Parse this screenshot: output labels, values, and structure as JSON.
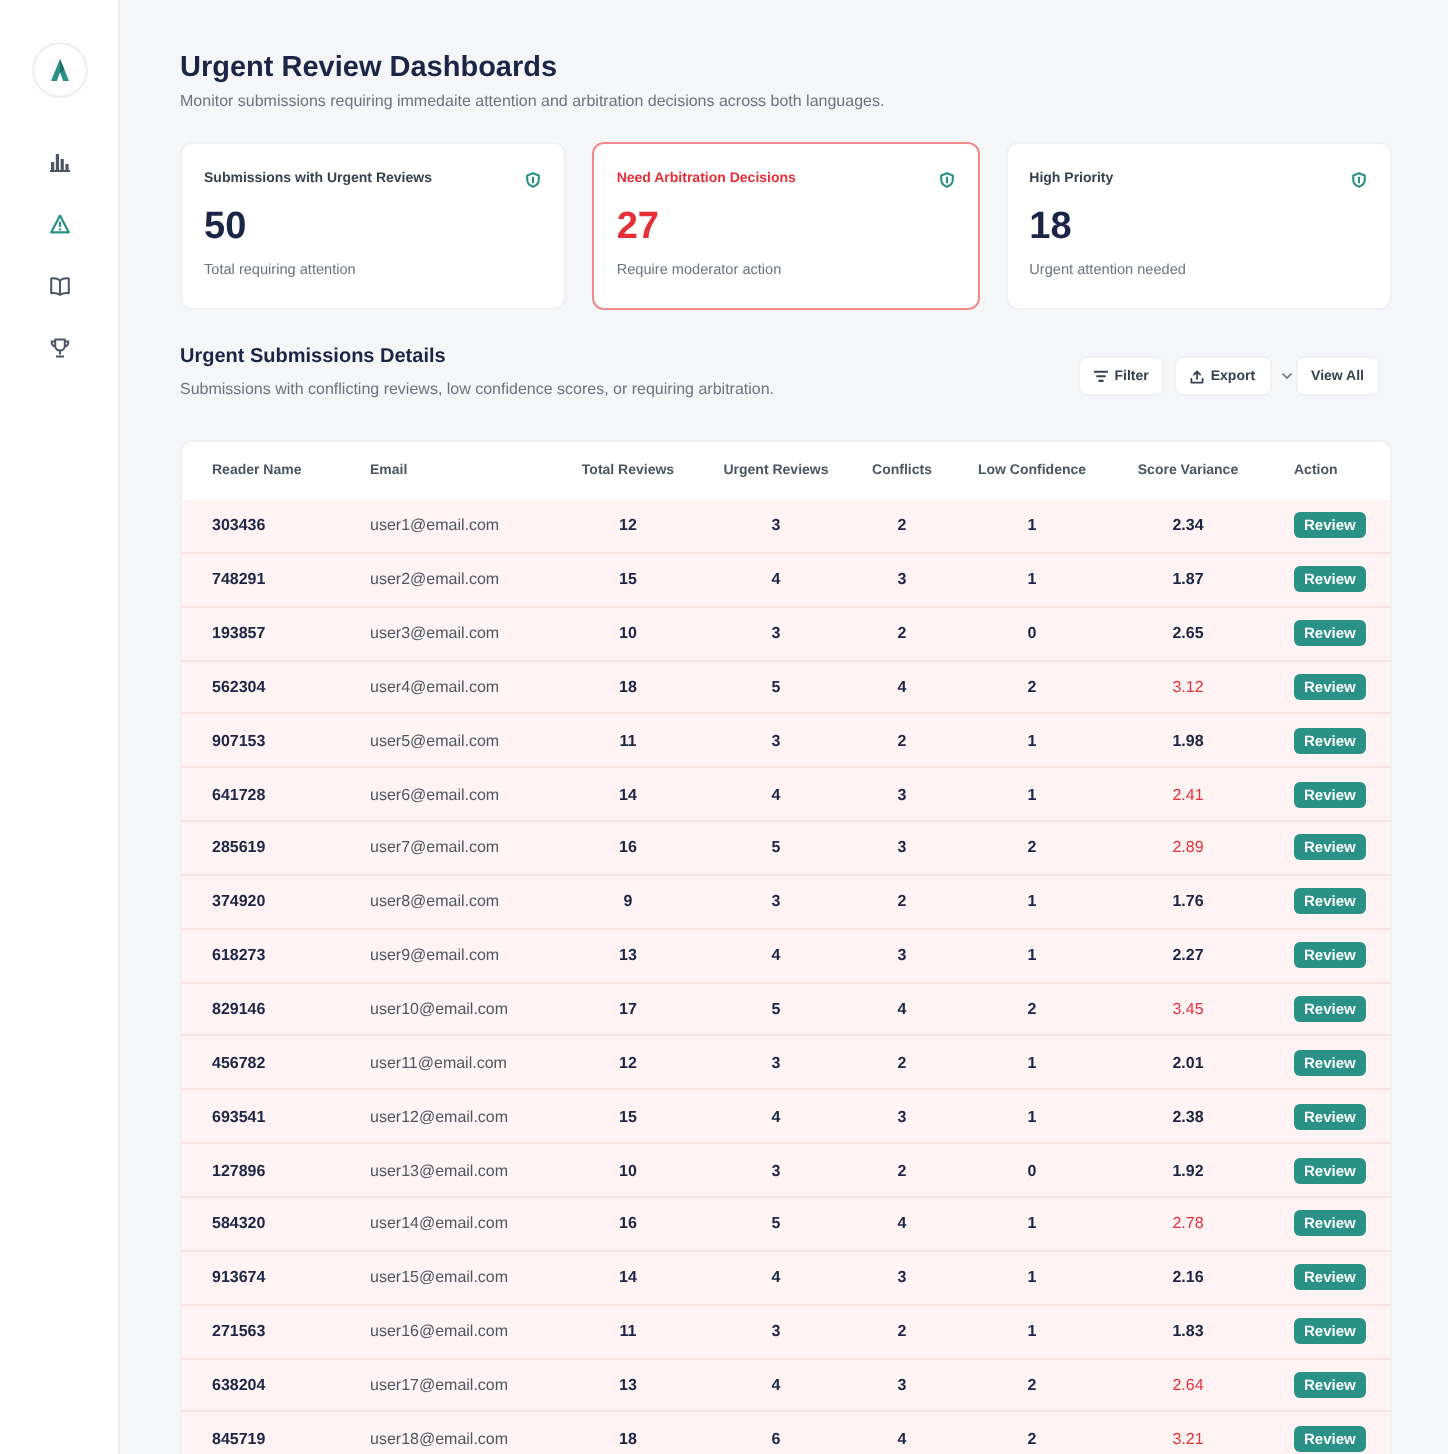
{
  "sidebar": {
    "items": [
      {
        "kind": "chart",
        "selected": false
      },
      {
        "kind": "alert",
        "selected": true
      },
      {
        "kind": "book",
        "selected": false
      },
      {
        "kind": "trophy",
        "selected": false
      }
    ]
  },
  "header": {
    "title": "Urgent Review Dashboards",
    "subtitle": "Monitor submissions requiring immedaite attention and arbitration decisions across both languages."
  },
  "cards": [
    {
      "title": "Submissions with Urgent Reviews",
      "value": "50",
      "caption": "Total requiring attention",
      "highlighted": false
    },
    {
      "title": "Need Arbitration Decisions",
      "value": "27",
      "caption": "Require moderator action",
      "highlighted": true
    },
    {
      "title": "High Priority",
      "value": "18",
      "caption": "Urgent attention needed",
      "highlighted": false
    }
  ],
  "section": {
    "title": "Urgent Submissions Details",
    "subtitle": "Submissions with conflicting reviews, low confidence scores, or requiring arbitration.",
    "buttons": [
      {
        "kind": "filter",
        "label": "Filter"
      },
      {
        "kind": "export",
        "label": "Export"
      },
      {
        "kind": "view_all",
        "label": "View All"
      }
    ]
  },
  "table": {
    "columns": [
      "Reader Name",
      "Email",
      "Total Reviews",
      "Urgent Reviews",
      "Conflicts",
      "Low Confidence",
      "Score Variance",
      "Action"
    ],
    "rows": [
      {
        "reader_name": "303436",
        "email": "user1@email.com",
        "total_reviews": "12",
        "urgent_reviews": "3",
        "conflicts": "2",
        "low_confidence": "1",
        "score_variance": "2.34",
        "variance_flagged": false,
        "action": "Review"
      },
      {
        "reader_name": "748291",
        "email": "user2@email.com",
        "total_reviews": "15",
        "urgent_reviews": "4",
        "conflicts": "3",
        "low_confidence": "1",
        "score_variance": "1.87",
        "variance_flagged": false,
        "action": "Review"
      },
      {
        "reader_name": "193857",
        "email": "user3@email.com",
        "total_reviews": "10",
        "urgent_reviews": "3",
        "conflicts": "2",
        "low_confidence": "0",
        "score_variance": "2.65",
        "variance_flagged": false,
        "action": "Review"
      },
      {
        "reader_name": "562304",
        "email": "user4@email.com",
        "total_reviews": "18",
        "urgent_reviews": "5",
        "conflicts": "4",
        "low_confidence": "2",
        "score_variance": "3.12",
        "variance_flagged": true,
        "action": "Review"
      },
      {
        "reader_name": "907153",
        "email": "user5@email.com",
        "total_reviews": "11",
        "urgent_reviews": "3",
        "conflicts": "2",
        "low_confidence": "1",
        "score_variance": "1.98",
        "variance_flagged": false,
        "action": "Review"
      },
      {
        "reader_name": "641728",
        "email": "user6@email.com",
        "total_reviews": "14",
        "urgent_reviews": "4",
        "conflicts": "3",
        "low_confidence": "1",
        "score_variance": "2.41",
        "variance_flagged": true,
        "action": "Review"
      },
      {
        "reader_name": "285619",
        "email": "user7@email.com",
        "total_reviews": "16",
        "urgent_reviews": "5",
        "conflicts": "3",
        "low_confidence": "2",
        "score_variance": "2.89",
        "variance_flagged": true,
        "action": "Review"
      },
      {
        "reader_name": "374920",
        "email": "user8@email.com",
        "total_reviews": "9",
        "urgent_reviews": "3",
        "conflicts": "2",
        "low_confidence": "1",
        "score_variance": "1.76",
        "variance_flagged": false,
        "action": "Review"
      },
      {
        "reader_name": "618273",
        "email": "user9@email.com",
        "total_reviews": "13",
        "urgent_reviews": "4",
        "conflicts": "3",
        "low_confidence": "1",
        "score_variance": "2.27",
        "variance_flagged": false,
        "action": "Review"
      },
      {
        "reader_name": "829146",
        "email": "user10@email.com",
        "total_reviews": "17",
        "urgent_reviews": "5",
        "conflicts": "4",
        "low_confidence": "2",
        "score_variance": "3.45",
        "variance_flagged": true,
        "action": "Review"
      },
      {
        "reader_name": "456782",
        "email": "user11@email.com",
        "total_reviews": "12",
        "urgent_reviews": "3",
        "conflicts": "2",
        "low_confidence": "1",
        "score_variance": "2.01",
        "variance_flagged": false,
        "action": "Review"
      },
      {
        "reader_name": "693541",
        "email": "user12@email.com",
        "total_reviews": "15",
        "urgent_reviews": "4",
        "conflicts": "3",
        "low_confidence": "1",
        "score_variance": "2.38",
        "variance_flagged": false,
        "action": "Review"
      },
      {
        "reader_name": "127896",
        "email": "user13@email.com",
        "total_reviews": "10",
        "urgent_reviews": "3",
        "conflicts": "2",
        "low_confidence": "0",
        "score_variance": "1.92",
        "variance_flagged": false,
        "action": "Review"
      },
      {
        "reader_name": "584320",
        "email": "user14@email.com",
        "total_reviews": "16",
        "urgent_reviews": "5",
        "conflicts": "4",
        "low_confidence": "1",
        "score_variance": "2.78",
        "variance_flagged": true,
        "action": "Review"
      },
      {
        "reader_name": "913674",
        "email": "user15@email.com",
        "total_reviews": "14",
        "urgent_reviews": "4",
        "conflicts": "3",
        "low_confidence": "1",
        "score_variance": "2.16",
        "variance_flagged": false,
        "action": "Review"
      },
      {
        "reader_name": "271563",
        "email": "user16@email.com",
        "total_reviews": "11",
        "urgent_reviews": "3",
        "conflicts": "2",
        "low_confidence": "1",
        "score_variance": "1.83",
        "variance_flagged": false,
        "action": "Review"
      },
      {
        "reader_name": "638204",
        "email": "user17@email.com",
        "total_reviews": "13",
        "urgent_reviews": "4",
        "conflicts": "3",
        "low_confidence": "2",
        "score_variance": "2.64",
        "variance_flagged": true,
        "action": "Review"
      },
      {
        "reader_name": "845719",
        "email": "user18@email.com",
        "total_reviews": "18",
        "urgent_reviews": "6",
        "conflicts": "4",
        "low_confidence": "2",
        "score_variance": "3.21",
        "variance_flagged": true,
        "action": "Review"
      }
    ]
  }
}
